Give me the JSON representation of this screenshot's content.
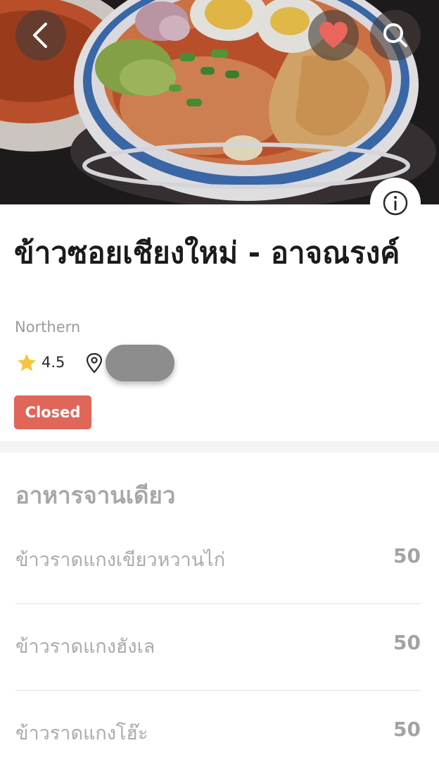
{
  "restaurant": {
    "name": "ข้าวซอยเชียงใหม่ - อาจณรงค์",
    "cuisine": "Northern",
    "rating": "4.5",
    "status": "Closed"
  },
  "icons": {
    "back": "chevron-left-icon",
    "favorite": "heart-icon",
    "search": "search-icon",
    "info": "info-icon",
    "rating": "star-icon",
    "location": "map-pin-icon"
  },
  "colors": {
    "favorite_heart": "#e8665b",
    "status_badge": "#e0665a",
    "star": "#f5c542",
    "hero_button_bg": "rgba(70,62,58,0.62)",
    "distance_pill": "#8d8d8d"
  },
  "menu": {
    "section_title": "อาหารจานเดียว",
    "items": [
      {
        "name": "ข้าวราดแกงเขียวหวานไก่",
        "price": "50"
      },
      {
        "name": "ข้าวราดแกงฮังเล",
        "price": "50"
      },
      {
        "name": "ข้าวราดแกงโฮ๊ะ",
        "price": "50"
      }
    ]
  }
}
